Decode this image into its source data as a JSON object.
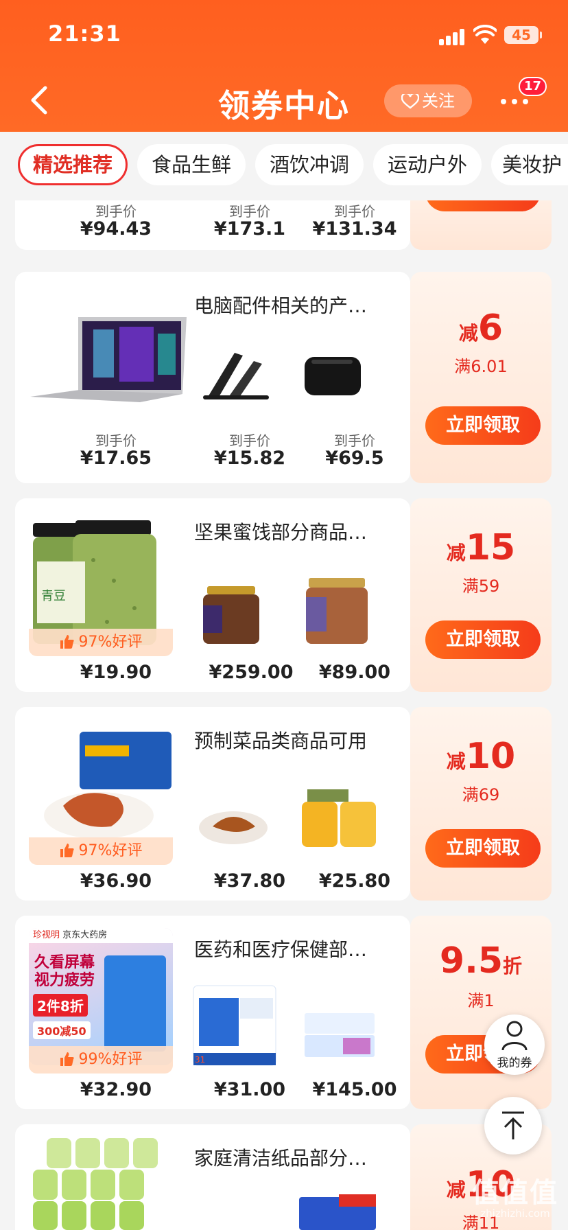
{
  "status_bar": {
    "time": "21:31",
    "battery": "45"
  },
  "nav": {
    "title": "领券中心",
    "follow_label": "关注",
    "message_badge": "17"
  },
  "tabs": [
    "精选推荐",
    "食品生鲜",
    "酒饮冲调",
    "运动户外",
    "美妆护"
  ],
  "active_tab": "精选推荐",
  "price_label": "到手价",
  "claim_label": "立即领取",
  "partial_card": {
    "prices": [
      "¥94.43",
      "¥173.1",
      "¥131.34"
    ],
    "claim_label": "立即领取"
  },
  "cards": [
    {
      "title": "电脑配件相关的产…",
      "cut_prefix": "减",
      "amount": "6",
      "threshold": "满6.01",
      "prices": [
        "¥17.65",
        "¥15.82",
        "¥69.5"
      ],
      "products": [
        "laptop",
        "laptop-stand",
        "speaker"
      ]
    },
    {
      "title": "坚果蜜饯部分商品…",
      "cut_prefix": "减",
      "amount": "15",
      "threshold": "满59",
      "rating": "97%好评",
      "prices": [
        "¥19.90",
        "¥259.00",
        "¥89.00"
      ],
      "products": [
        "green-bean-jar",
        "nut-jar-dark",
        "nut-jar-light"
      ]
    },
    {
      "title": "预制菜品类商品可用",
      "cut_prefix": "减",
      "amount": "10",
      "threshold": "满69",
      "rating": "97%好评",
      "prices": [
        "¥36.90",
        "¥37.80",
        "¥25.80"
      ],
      "products": [
        "prepared-dish",
        "noodle-plate",
        "millet-cake"
      ]
    },
    {
      "title": "医药和医疗保健部…",
      "amount": "9.5",
      "suffix": "折",
      "threshold": "满1",
      "rating": "99%好评",
      "prices": [
        "¥32.90",
        "¥31.00",
        "¥145.00"
      ],
      "products": [
        "eye-drops",
        "medicine-box",
        "vitamin-box"
      ],
      "promo_lines": [
        "珍视明",
        "京东大药房",
        "久看屏幕",
        "视力疲劳",
        "2件8折",
        "300减50"
      ]
    },
    {
      "title": "家庭清洁纸品部分…",
      "cut_prefix": "减",
      "amount": "10",
      "threshold": "满11",
      "products": [
        "toilet-paper",
        "tissue-box"
      ]
    }
  ],
  "floating": {
    "my_coupon_label": "我的券"
  },
  "watermark": {
    "big": "值值值",
    "small": "zhizhizhi.com"
  },
  "colors": {
    "brand": "#ff6a26",
    "accent_red": "#e42a1f"
  }
}
